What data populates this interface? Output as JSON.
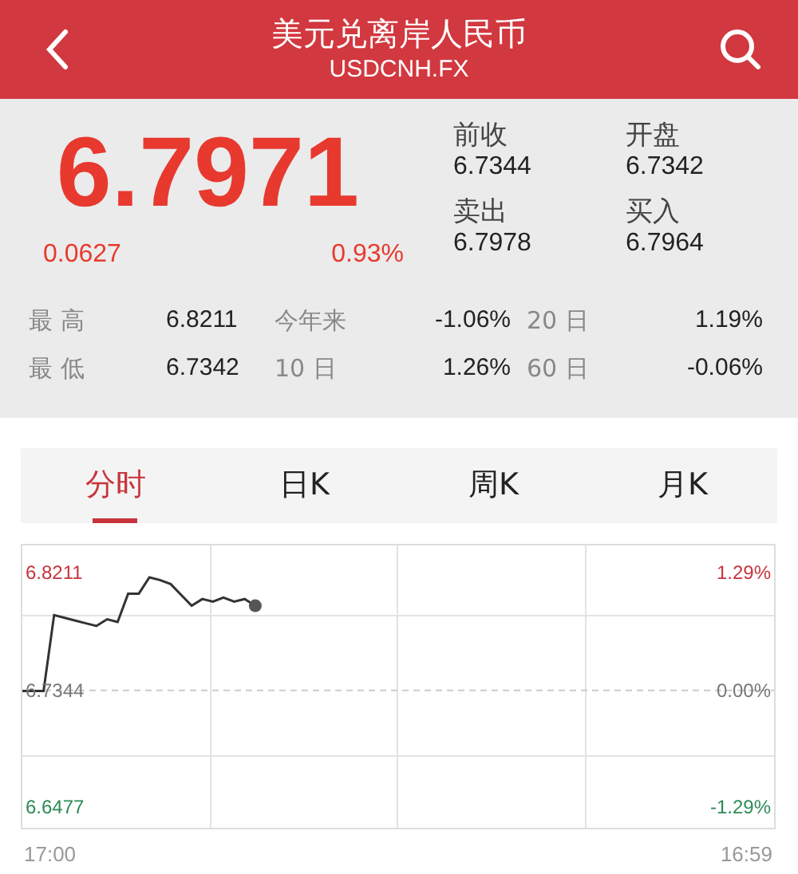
{
  "header": {
    "title": "美元兑离岸人民币",
    "subtitle": "USDCNH.FX"
  },
  "quote": {
    "price": "6.7971",
    "change": "0.0627",
    "change_pct": "0.93%",
    "fields": [
      {
        "label": "前收",
        "value": "6.7344"
      },
      {
        "label": "开盘",
        "value": "6.7342"
      },
      {
        "label": "卖出",
        "value": "6.7978"
      },
      {
        "label": "买入",
        "value": "6.7964"
      }
    ]
  },
  "stats": [
    [
      {
        "label": "最 高",
        "value": "6.8211"
      },
      {
        "label": "今年来",
        "value": "-1.06%"
      },
      {
        "label": "20 日",
        "value": "1.19%"
      }
    ],
    [
      {
        "label": "最 低",
        "value": "6.7342"
      },
      {
        "label": "10 日",
        "value": "1.26%"
      },
      {
        "label": "60 日",
        "value": "-0.06%"
      }
    ]
  ],
  "tabs": [
    {
      "label": "分时",
      "selected": true
    },
    {
      "label": "日K",
      "selected": false
    },
    {
      "label": "周K",
      "selected": false
    },
    {
      "label": "月K",
      "selected": false
    }
  ],
  "chart": {
    "right_labels": [
      {
        "text": "1.29%",
        "color": "#c8343c"
      },
      {
        "text": "0.00%",
        "color": "#777777"
      },
      {
        "text": "-1.29%",
        "color": "#2e8b57"
      }
    ],
    "time_labels": [
      "17:00",
      "16:59"
    ],
    "chart_data": {
      "type": "line",
      "categories": [
        null,
        null,
        null,
        null,
        null,
        null,
        null,
        null,
        null,
        null,
        null,
        null,
        null,
        null,
        null,
        null,
        null,
        null,
        null,
        null,
        null,
        null,
        null,
        null,
        null,
        null,
        null,
        null,
        null,
        null,
        null,
        null,
        null,
        null,
        null,
        null,
        null,
        null,
        null,
        null,
        null,
        null,
        null,
        null,
        null,
        null,
        null,
        null,
        null,
        null,
        null,
        null,
        null,
        null,
        null,
        null,
        null,
        null,
        null,
        null,
        null,
        null,
        null,
        null,
        null,
        null,
        null,
        null,
        null,
        null,
        null,
        null
      ],
      "series": [
        {
          "color": "#333333",
          "values": [
            6.734,
            6.734,
            6.734,
            6.79,
            6.788,
            6.786,
            6.784,
            6.782,
            6.787,
            6.785,
            6.806,
            6.806,
            6.818,
            6.816,
            6.813,
            6.805,
            6.797,
            6.802,
            6.8,
            6.803,
            6.8,
            6.802,
            6.797,
            null,
            null,
            null,
            null,
            null,
            null,
            null,
            null,
            null,
            null,
            null,
            null,
            null,
            null,
            null,
            null,
            null,
            null,
            null,
            null,
            null,
            null,
            null,
            null,
            null,
            null,
            null,
            null,
            null,
            null,
            null,
            null,
            null,
            null,
            null,
            null,
            null,
            null,
            null,
            null,
            null,
            null,
            null,
            null,
            null,
            null,
            null,
            null,
            null
          ]
        }
      ],
      "ylim": [
        6.6327,
        6.8416
      ],
      "ref_lines": [
        {
          "axis": "y",
          "value": 6.7344
        }
      ],
      "yticks": [
        {
          "value": 6.8211,
          "label": "6.8211"
        },
        {
          "value": 6.7344,
          "label": "6.7344"
        },
        {
          "value": 6.6477,
          "label": "6.6477"
        }
      ]
    }
  }
}
